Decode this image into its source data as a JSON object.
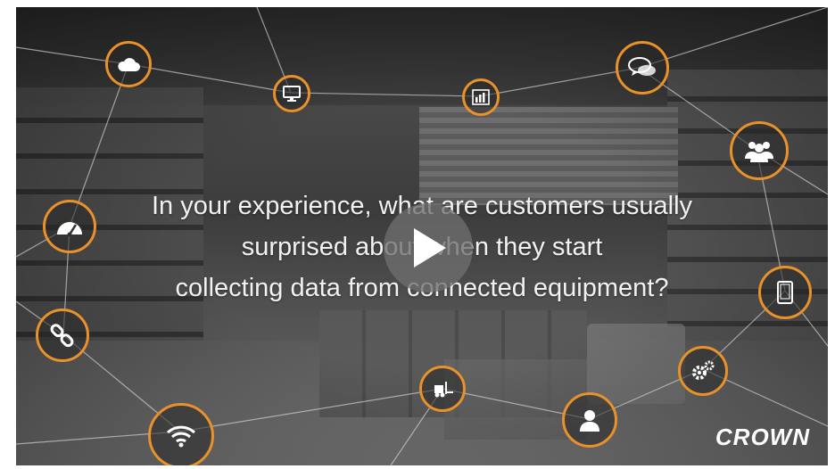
{
  "video": {
    "question_lines": [
      "In your experience, what are customers usually",
      "surprised about when they start",
      "collecting data from connected equipment?"
    ],
    "brand": "CROWN",
    "accent_color": "#e9912a"
  },
  "icons": [
    {
      "name": "cloud-icon"
    },
    {
      "name": "monitor-icon"
    },
    {
      "name": "bar-chart-icon"
    },
    {
      "name": "chat-bubbles-icon"
    },
    {
      "name": "users-group-icon"
    },
    {
      "name": "gauge-icon"
    },
    {
      "name": "tablet-icon"
    },
    {
      "name": "link-icon"
    },
    {
      "name": "gears-icon"
    },
    {
      "name": "wifi-icon"
    },
    {
      "name": "forklift-icon"
    },
    {
      "name": "user-icon"
    }
  ],
  "controls": {
    "play_icon": "play-icon"
  }
}
